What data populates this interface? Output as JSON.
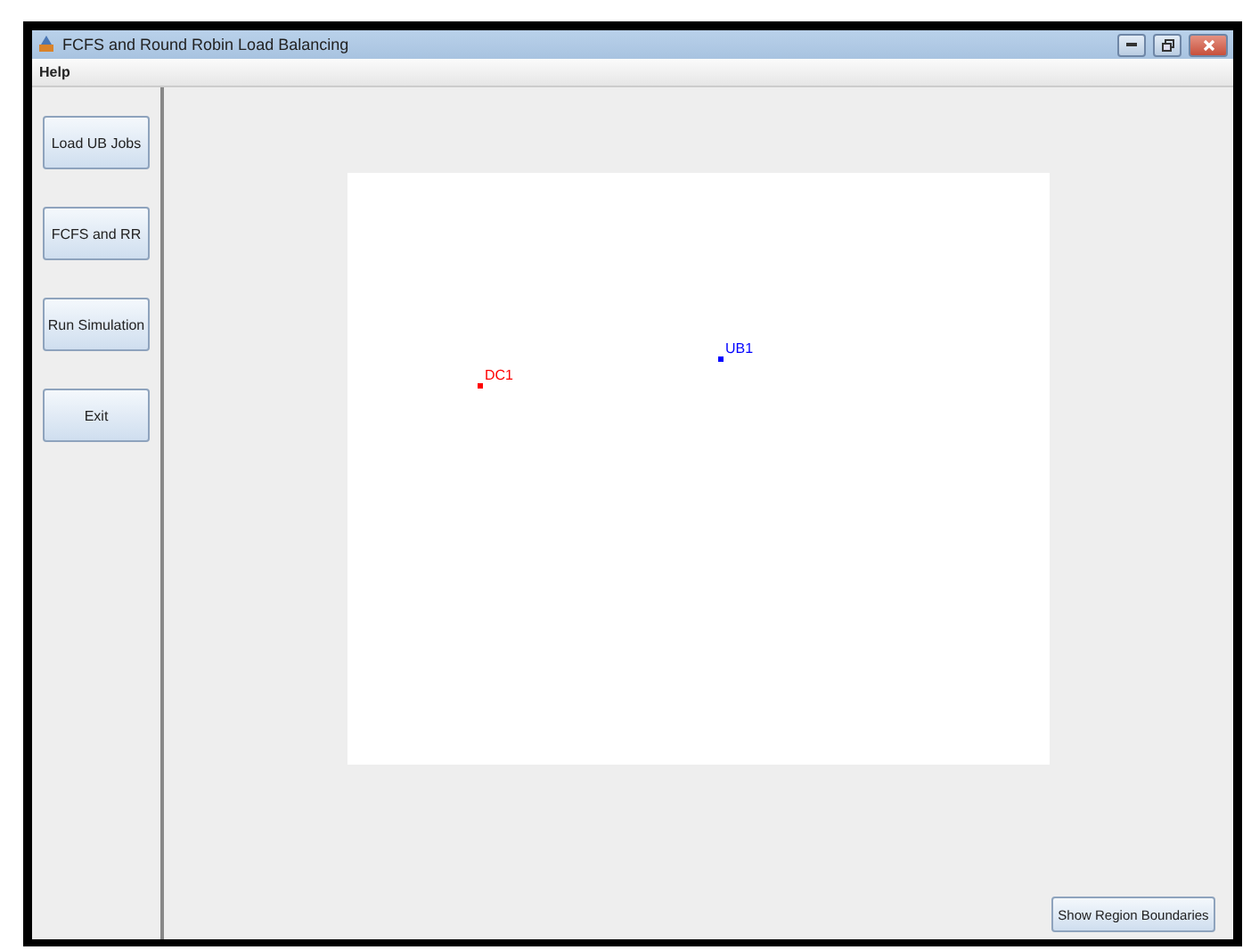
{
  "window": {
    "title": "FCFS and Round Robin Load Balancing"
  },
  "menu": [
    "Help"
  ],
  "sidebar_buttons": [
    "Load UB Jobs",
    "FCFS and RR",
    "Run Simulation",
    "Exit"
  ],
  "canvas": {
    "nodes": [
      {
        "label": "DC1",
        "color": "#ff0000"
      },
      {
        "label": "UB1",
        "color": "#0000ff"
      }
    ]
  },
  "bottom_button": "Show Region Boundaries"
}
